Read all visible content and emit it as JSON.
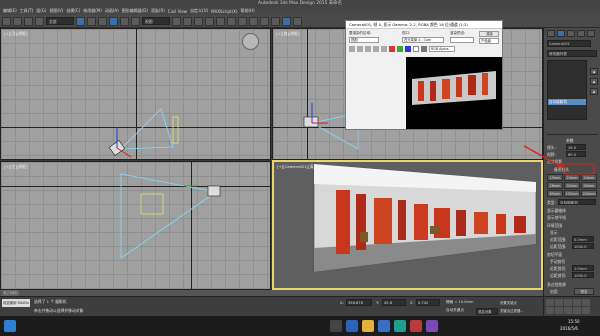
{
  "app": {
    "title": "Autodesk 3ds Max Design 2015  未命名"
  },
  "menubar": [
    "编辑(E)",
    "工具(T)",
    "组(G)",
    "视图(V)",
    "创建(C)",
    "修改器(M)",
    "动画(A)",
    "图形编辑器(D)",
    "渲染(R)",
    "Civil View",
    "自定义(U)",
    "MAXScript(X)",
    "帮助(H)"
  ],
  "toolbar": {
    "selection_filter": "全部",
    "view_dropdown": "视图"
  },
  "viewports": {
    "top_left": "[+][顶][线框]",
    "top_right": "[+][前][线框]",
    "bottom_left": "[+][左][线框]",
    "bottom_right": "[+][Camera001][真实]"
  },
  "render_window": {
    "title": "Camera001, 帧 0, 显示 Gamma: 2.2, RGBA 颜色 16 位/通道 (1:2)",
    "area_label": "要渲染的区域:",
    "area_value": "视图",
    "viewport_label": "视口:",
    "viewport_value": "四元菜单 4 - Cam",
    "preset_label": "渲染预设:",
    "preset_value": "",
    "render_button": "渲染",
    "production_value": "产品级",
    "channel_value": "RGB Alpha"
  },
  "right_panel": {
    "object_name": "Camera001",
    "modifier_list": "修改器列表",
    "target_camera": "目标摄影机",
    "section_params": "参数",
    "lens_label": "镜头:",
    "lens_value": "26.0",
    "fov_label": "视野:",
    "fov_value": "69.0",
    "ortho_label": "正交投影",
    "stock_lens_title": "备用镜头",
    "lenses": [
      "15mm",
      "20mm",
      "24mm",
      "28mm",
      "35mm",
      "50mm",
      "85mm",
      "135mm",
      "200mm"
    ],
    "type_label": "类型:",
    "type_value": "目标摄影机",
    "show_cone": "显示圆锥体",
    "show_horizon": "显示地平线",
    "env_range": "环境范围",
    "show": "显示",
    "near_range_label": "近距范围:",
    "near_range_value": "0.0mm",
    "far_range_label": "远距范围:",
    "far_range_value": "1000.0",
    "clip_title": "剪切平面",
    "manual_clip": "手动剪切",
    "near_clip_label": "近距剪切:",
    "near_clip_value": "1.0mm",
    "far_clip_label": "远距剪切:",
    "far_clip_value": "1000.0",
    "multipass": "多过程效果",
    "enable": "启用",
    "preview": "预览"
  },
  "status": {
    "selected": "选择了 1 个 摄影机",
    "hint": "单击并拖动以选择并移动对象",
    "welcome": "欢迎使用 MAXSc",
    "frame": "0 / 100",
    "x_label": "X:",
    "x_value": "356.876",
    "y_label": "Y:",
    "y_value": "45.8",
    "z_label": "Z:",
    "z_value": "0.742",
    "grid": "栅格 = 10.0mm",
    "autokey": "自动关键点",
    "selected_obj": "选定对象",
    "setkey": "设置关键点",
    "keyfilter": "关键点过滤器..."
  },
  "taskbar": {
    "time": "15:50",
    "date": "2016/5/6"
  },
  "colors": {
    "accent": "#e8d56b",
    "annotation": "#d9261c",
    "taskbar": "#1c1c1c"
  }
}
